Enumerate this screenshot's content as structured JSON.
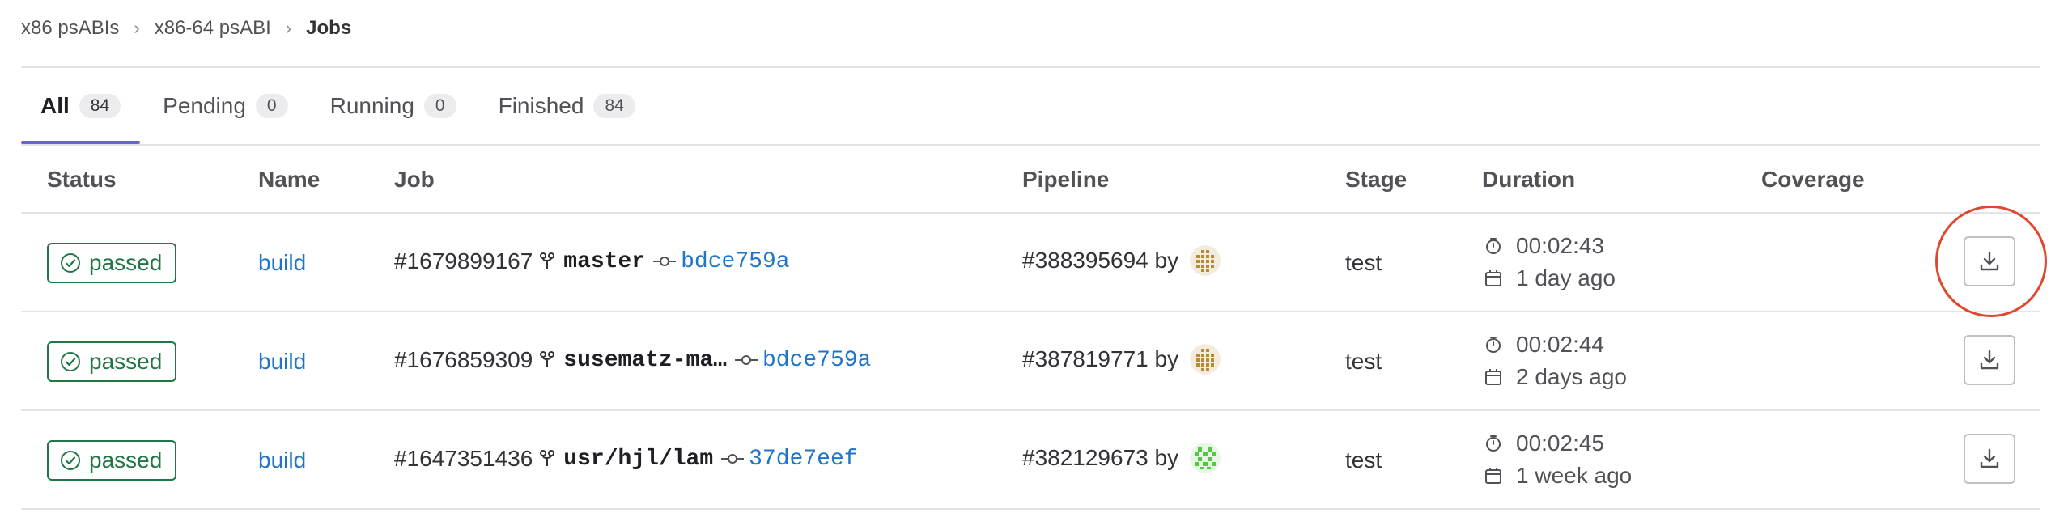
{
  "breadcrumb": {
    "items": [
      "x86 psABIs",
      "x86-64 psABI"
    ],
    "current": "Jobs"
  },
  "tabs": [
    {
      "label": "All",
      "count": "84",
      "active": true
    },
    {
      "label": "Pending",
      "count": "0"
    },
    {
      "label": "Running",
      "count": "0"
    },
    {
      "label": "Finished",
      "count": "84"
    }
  ],
  "table": {
    "headers": {
      "status": "Status",
      "name": "Name",
      "job": "Job",
      "pipeline": "Pipeline",
      "stage": "Stage",
      "duration": "Duration",
      "coverage": "Coverage"
    },
    "rows": [
      {
        "status": "passed",
        "name": "build",
        "job_id": "#1679899167",
        "branch": "master",
        "sha": "bdce759a",
        "pipeline": "#388395694 by",
        "stage": "test",
        "duration": "00:02:43",
        "finished": "1 day ago"
      },
      {
        "status": "passed",
        "name": "build",
        "job_id": "#1676859309",
        "branch": "susematz-ma…",
        "sha": "bdce759a",
        "pipeline": "#387819771 by",
        "stage": "test",
        "duration": "00:02:44",
        "finished": "2 days ago"
      },
      {
        "status": "passed",
        "name": "build",
        "job_id": "#1647351436",
        "branch": "usr/hjl/lam",
        "sha": "37de7eef",
        "pipeline": "#382129673 by",
        "stage": "test",
        "duration": "00:02:45",
        "finished": "1 week ago"
      }
    ]
  },
  "colors": {
    "passed": "#217645",
    "link": "#1f75cb",
    "tab_active_underline": "#6666c4",
    "annotation": "#e0472f"
  },
  "icons": {
    "status": "check-circle-icon",
    "branch": "branch-icon",
    "commit": "commit-icon",
    "timer": "timer-icon",
    "calendar": "calendar-icon",
    "download": "download-icon"
  }
}
